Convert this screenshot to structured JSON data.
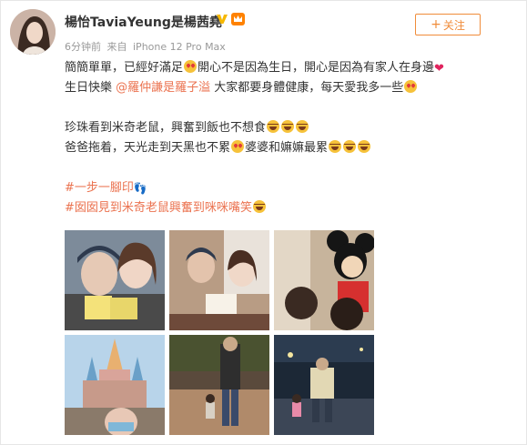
{
  "post": {
    "username": "楊怡TaviaYeung是楊茜堯",
    "time": "6分钟前",
    "source_prefix": "来自",
    "source": "iPhone 12 Pro Max",
    "follow_label": "关注",
    "follow_icon": "plus-icon"
  },
  "text": {
    "l1a": "簡簡單單，已經好滿足",
    "l1b": "開心不是因為生日，開心是因為有家人在身邊",
    "l2a": "生日快樂 ",
    "l2_mention": "@羅仲謙是羅子溢",
    "l2b": " 大家都要身體健康，每天愛我多一些",
    "l3": "珍珠看到米奇老鼠，興奮到飯也不想食",
    "l4a": "爸爸拖着，天光走到天黑也不累",
    "l4b": "婆婆和嫲嫲最累",
    "hashtag1": "#一步一腳印",
    "hashtag2": "#囡囡見到米奇老鼠興奮到咪咪嘴笑"
  },
  "images": [
    {
      "name": "photo-selfie-family",
      "colors": [
        "#6e7d90",
        "#e8d3c4",
        "#3a3a3a"
      ]
    },
    {
      "name": "photo-birthday-cake",
      "colors": [
        "#8a6f5c",
        "#f2e8dc",
        "#c9a98a"
      ]
    },
    {
      "name": "photo-mickey-mouse",
      "colors": [
        "#b9a58e",
        "#1f1f1f",
        "#e03a3a"
      ]
    },
    {
      "name": "photo-castle",
      "colors": [
        "#9fc2e0",
        "#c79a8a",
        "#6aa0c8"
      ]
    },
    {
      "name": "photo-evening-walk",
      "colors": [
        "#6b5a4a",
        "#4f5a3a",
        "#d0c2ae"
      ]
    },
    {
      "name": "photo-night-park",
      "colors": [
        "#1b2a3a",
        "#3b4a5a",
        "#d8d0b0"
      ]
    }
  ],
  "badges": {
    "verified": "verified-v-icon",
    "vip": "vip-crown-icon"
  },
  "accent_color": "#eb7350"
}
